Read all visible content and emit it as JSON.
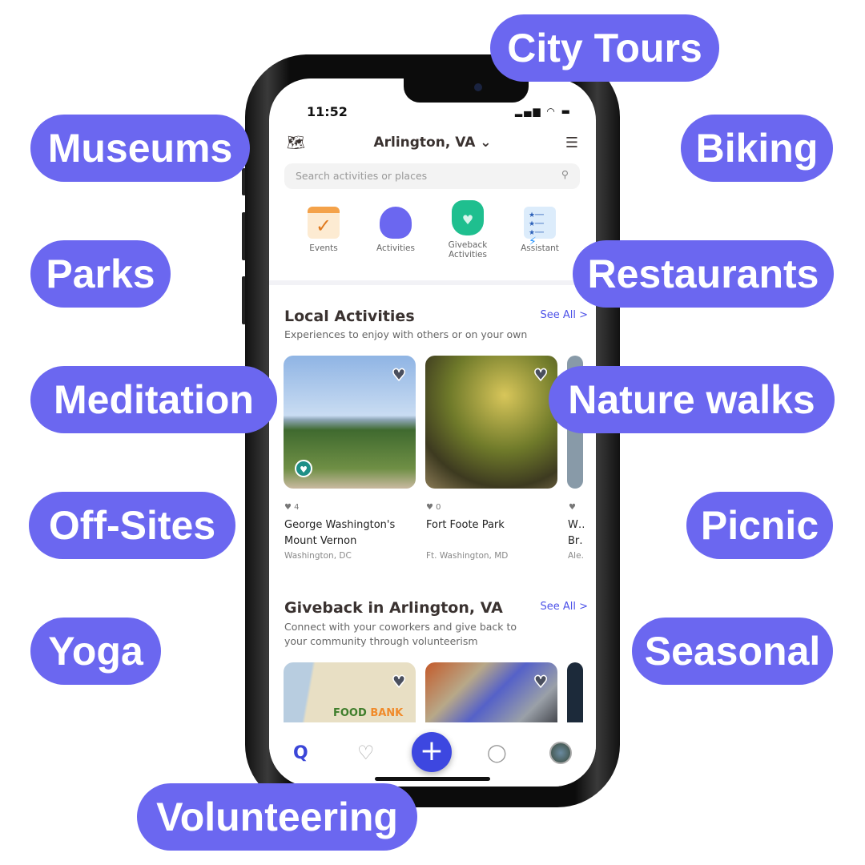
{
  "pills": [
    "City Tours",
    "Museums",
    "Biking",
    "Parks",
    "Restaurants",
    "Meditation",
    "Nature walks",
    "Off-Sites",
    "Picnic",
    "Yoga",
    "Seasonal",
    "Volunteering"
  ],
  "accent": "#6B67F0",
  "status": {
    "time": "11:52"
  },
  "header": {
    "location": "Arlington, VA",
    "map_icon": "map-icon",
    "filter_icon": "sliders-icon"
  },
  "search": {
    "placeholder": "Search activities or places"
  },
  "categories": [
    {
      "label": "Events"
    },
    {
      "label": "Activities"
    },
    {
      "label": "Giveback Activities"
    },
    {
      "label": "Assistant"
    }
  ],
  "local": {
    "title": "Local Activities",
    "subtitle": "Experiences to enjoy with others or on your own",
    "see_all": "See All >",
    "cards": [
      {
        "likes": "4",
        "name": "George Washington's Mount Vernon",
        "place": "Washington, DC"
      },
      {
        "likes": "0",
        "name": "Fort Foote Park",
        "place": "Ft. Washington, MD"
      },
      {
        "likes": "",
        "name": "W… Br…",
        "place": "Ale…"
      }
    ]
  },
  "giveback": {
    "title": "Giveback in Arlington, VA",
    "subtitle": "Connect with your coworkers and give back to your community through volunteerism",
    "see_all": "See All >"
  },
  "nav": [
    "search",
    "favorites",
    "add",
    "messages",
    "profile"
  ]
}
